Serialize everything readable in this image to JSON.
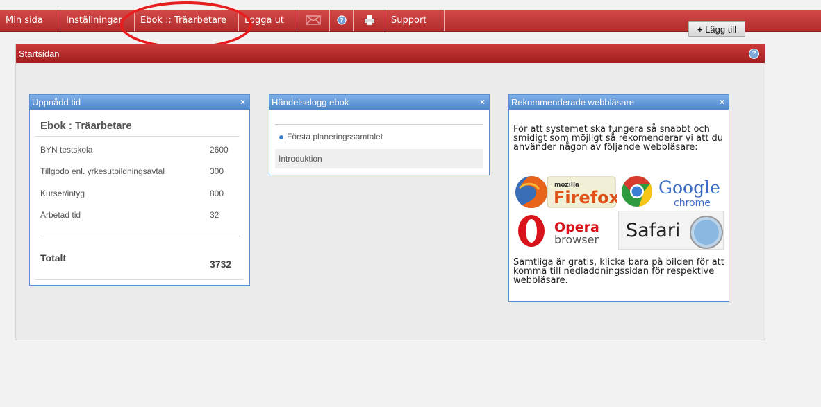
{
  "nav": {
    "items": [
      {
        "label": "Min sida"
      },
      {
        "label": "Inställningar"
      },
      {
        "label": "Ebok :: Träarbetare"
      },
      {
        "label": "Logga ut"
      },
      {
        "icon": "mail-icon"
      },
      {
        "icon": "help-icon"
      },
      {
        "icon": "print-icon"
      },
      {
        "label": "Support"
      }
    ]
  },
  "panel": {
    "title": "Startsidan",
    "add_label": "Lägg till",
    "add_symbol": "+"
  },
  "widget_time": {
    "header": "Uppnådd tid",
    "close": "×",
    "title": "Ebok : Träarbetare",
    "rows": [
      {
        "label": "BYN testskola",
        "value": "2600"
      },
      {
        "label": "Tillgodo enl. yrkesutbildningsavtal",
        "value": "300"
      },
      {
        "label": "Kurser/intyg",
        "value": "800"
      },
      {
        "label": "Arbetad tid",
        "value": "32"
      }
    ],
    "total_label": "Totalt",
    "total_value": "3732"
  },
  "widget_log": {
    "header": "Händelselogg ebok",
    "close": "×",
    "items": [
      "Första planeringssamtalet",
      "Introduktion"
    ]
  },
  "widget_browsers": {
    "header": "Rekommenderade webbläsare",
    "close": "×",
    "intro": "För att systemet ska fungera så snabbt och smidigt som möjligt så rekomenderar vi att du använder någon av följande webbläsare:",
    "outro": "Samtliga är gratis, klicka bara på bilden för att komma till nedladdningssidan för respektive webbläsare.",
    "logos": {
      "firefox_top": "mozilla",
      "firefox_main": "Firefox",
      "chrome_main": "Google",
      "chrome_sub": "chrome",
      "opera_main": "Opera",
      "opera_sub": "browser",
      "safari_main": "Safari"
    }
  }
}
